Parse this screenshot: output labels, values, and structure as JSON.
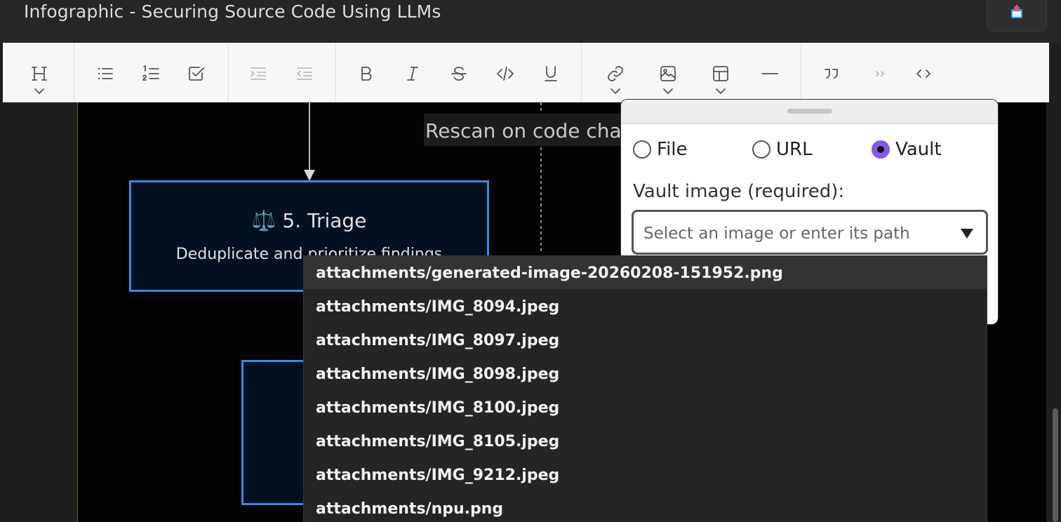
{
  "window": {
    "title": "Infographic - Securing Source Code Using LLMs"
  },
  "toolbar": {
    "buttons": [
      "heading",
      "bulleted-list",
      "numbered-list",
      "checklist",
      "indent",
      "outdent",
      "bold",
      "italic",
      "strikethrough",
      "inline-code",
      "underline",
      "link",
      "image",
      "table",
      "horizontal-rule",
      "blockquote",
      "footnote",
      "code"
    ]
  },
  "diagram": {
    "annotation": "Rescan on code cha",
    "triage_node": {
      "icon": "⚖️",
      "title": "5. Triage",
      "subtitle": "Deduplicate and prioritize findings"
    }
  },
  "image_dialog": {
    "sources": [
      {
        "label": "File",
        "selected": false
      },
      {
        "label": "URL",
        "selected": false
      },
      {
        "label": "Vault",
        "selected": true
      }
    ],
    "field_label": "Vault image (required):",
    "select_placeholder": "Select an image or enter its path",
    "accent_color": "#8757e8"
  },
  "dropdown": {
    "items": [
      "attachments/generated-image-20260208-151952.png",
      "attachments/IMG_8094.jpeg",
      "attachments/IMG_8097.jpeg",
      "attachments/IMG_8098.jpeg",
      "attachments/IMG_8100.jpeg",
      "attachments/IMG_8105.jpeg",
      "attachments/IMG_9212.jpeg",
      "attachments/npu.png"
    ],
    "highlighted_index": 0
  },
  "colors": {
    "node_border": "#2f8ee8",
    "node_fill": "#021020",
    "canvas": "#030303"
  }
}
